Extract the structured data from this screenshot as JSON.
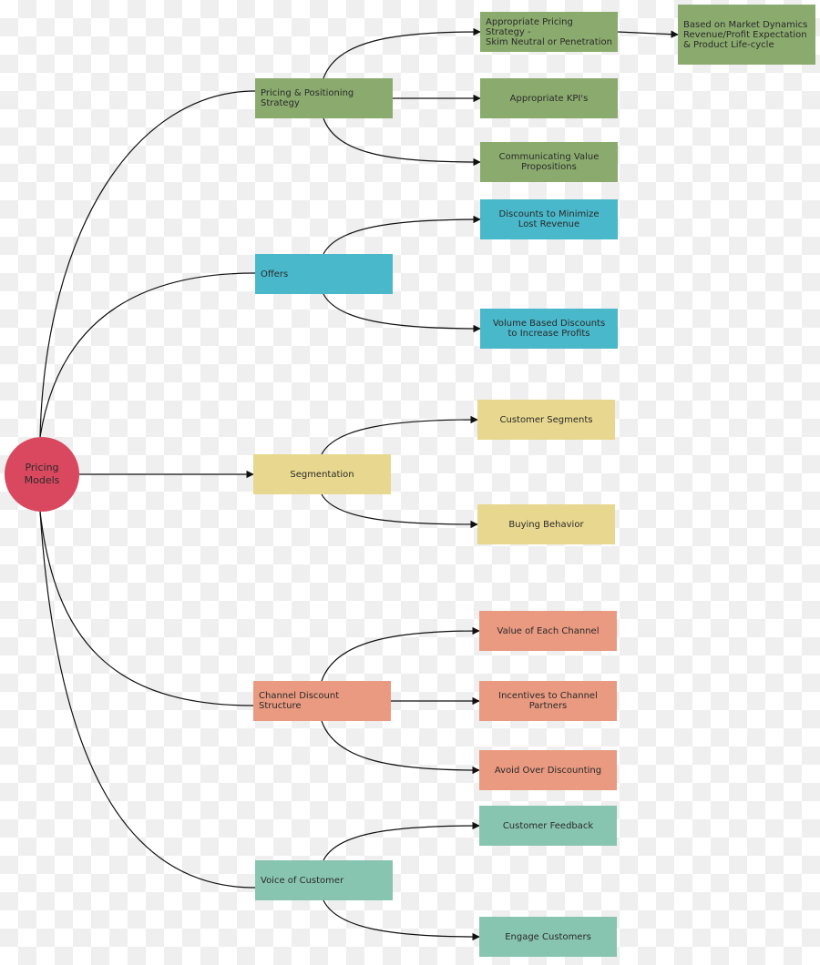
{
  "diagram": {
    "type": "mind-map",
    "root": {
      "label": "Pricing\nModels",
      "color": "#d9485f"
    },
    "branches": [
      {
        "label": "Pricing & Positioning\nStrategy",
        "color": "#8bab6e",
        "children": [
          {
            "label": "Appropriate Pricing Strategy -\nSkim Neutral or Penetration",
            "child": {
              "label": "Based on Market Dynamics\nRevenue/Profit Expectation\n& Product Life-cycle"
            }
          },
          {
            "label": "Appropriate KPI's"
          },
          {
            "label": "Communicating Value\nPropositions"
          }
        ]
      },
      {
        "label": "Offers",
        "color": "#49b8ca",
        "children": [
          {
            "label": "Discounts to Minimize\nLost Revenue"
          },
          {
            "label": "Volume Based Discounts\nto Increase Profits"
          }
        ]
      },
      {
        "label": "Segmentation",
        "color": "#e8d78e",
        "children": [
          {
            "label": "Customer Segments"
          },
          {
            "label": "Buying Behavior"
          }
        ]
      },
      {
        "label": "Channel Discount\nStructure",
        "color": "#e99a80",
        "children": [
          {
            "label": "Value of Each Channel"
          },
          {
            "label": "Incentives to Channel\nPartners"
          },
          {
            "label": "Avoid Over Discounting"
          }
        ]
      },
      {
        "label": "Voice of Customer",
        "color": "#88c5b0",
        "children": [
          {
            "label": "Customer Feedback"
          },
          {
            "label": "Engage Customers"
          }
        ]
      }
    ]
  }
}
